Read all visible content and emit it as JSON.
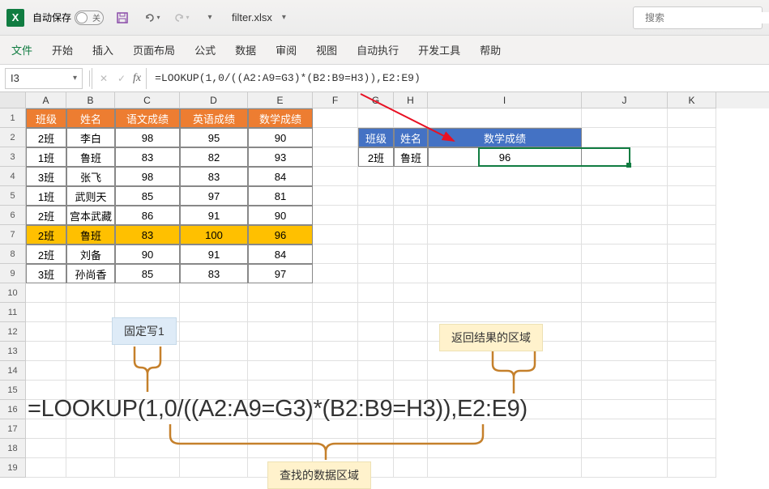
{
  "titlebar": {
    "autosave_label": "自动保存",
    "autosave_off": "关",
    "filename": "filter.xlsx",
    "search_placeholder": "搜索"
  },
  "ribbon": {
    "tabs": [
      "文件",
      "开始",
      "插入",
      "页面布局",
      "公式",
      "数据",
      "审阅",
      "视图",
      "自动执行",
      "开发工具",
      "帮助"
    ]
  },
  "formulabar": {
    "namebox": "I3",
    "formula": "=LOOKUP(1,0/((A2:A9=G3)*(B2:B9=H3)),E2:E9)"
  },
  "columns": [
    "A",
    "B",
    "C",
    "D",
    "E",
    "F",
    "G",
    "H",
    "I",
    "J",
    "K"
  ],
  "row_numbers": [
    "1",
    "2",
    "3",
    "4",
    "5",
    "6",
    "7",
    "8",
    "9",
    "10",
    "11",
    "12",
    "13",
    "14",
    "15",
    "16",
    "17",
    "18",
    "19"
  ],
  "table1": {
    "headers": [
      "班级",
      "姓名",
      "语文成绩",
      "英语成绩",
      "数学成绩"
    ],
    "rows": [
      [
        "2班",
        "李白",
        "98",
        "95",
        "90"
      ],
      [
        "1班",
        "鲁班",
        "83",
        "82",
        "93"
      ],
      [
        "3班",
        "张飞",
        "98",
        "83",
        "84"
      ],
      [
        "1班",
        "武则天",
        "85",
        "97",
        "81"
      ],
      [
        "2班",
        "宫本武藏",
        "86",
        "91",
        "90"
      ],
      [
        "2班",
        "鲁班",
        "83",
        "100",
        "96"
      ],
      [
        "2班",
        "刘备",
        "90",
        "91",
        "84"
      ],
      [
        "3班",
        "孙尚香",
        "85",
        "83",
        "97"
      ]
    ],
    "highlight_row_index": 5
  },
  "table2": {
    "headers": [
      "班级",
      "姓名",
      "数学成绩"
    ],
    "row": [
      "2班",
      "鲁班",
      "96"
    ]
  },
  "callouts": {
    "fixed1": "固定写1",
    "result": "返回结果的区域",
    "lookup_range": "查找的数据区域"
  },
  "big_formula": "=LOOKUP(1,0/((A2:A9=G3)*(B2:B9=H3)),E2:E9)",
  "icons": {
    "app": "X",
    "save": "save-icon",
    "undo": "undo-icon",
    "redo": "redo-icon",
    "dropdown": "chevron-down-icon",
    "cancel": "✕",
    "confirm": "✓",
    "fx": "fx",
    "search": "search-icon"
  },
  "colors": {
    "orange_header": "#ed7d31",
    "blue_header": "#4472c4",
    "yellow_highlight": "#ffc000",
    "excel_green": "#107c41"
  }
}
